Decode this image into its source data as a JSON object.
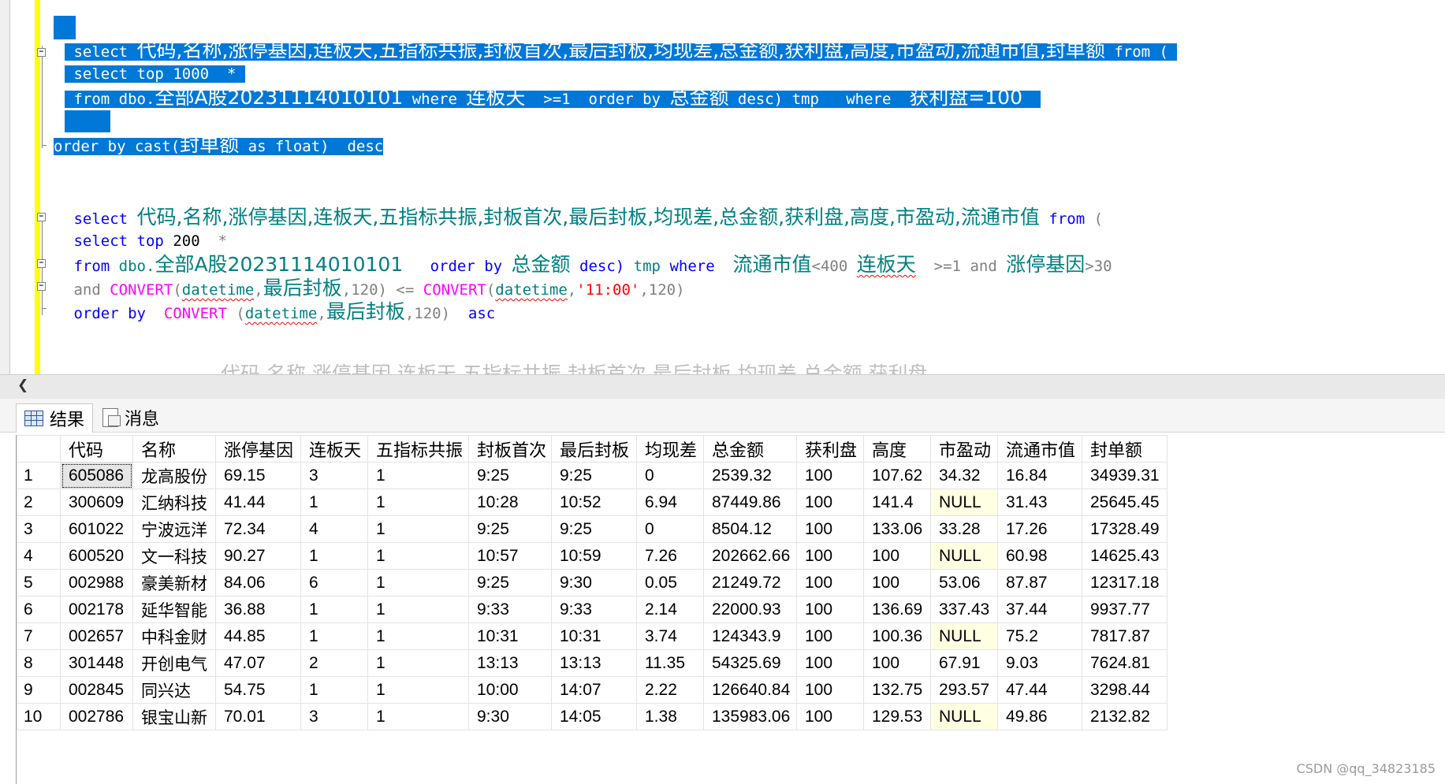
{
  "editor": {
    "block1": {
      "l1": {
        "kw1": "select",
        "cols": "代码,名称,涨停基因,连板天,五指标共振,封板首次,最后封板,均现差,总金额,获利盘,高度,市盈动,流通市值,封单额",
        "kw2": "from",
        "paren": "("
      },
      "l2": {
        "kw1": "select",
        "kw2": "top",
        "num": "1000",
        "star": "*"
      },
      "l3": {
        "kw1": "from",
        "obj1": "dbo.",
        "tbl": "全部A股20231114010101",
        "kw2": "where",
        "col1": "连板天",
        "op1": ">=1",
        "kw3": "order by",
        "col2": "总金额",
        "kw4": "desc)",
        "alias": "tmp",
        "kw5": "where",
        "col3": "获利盘=100"
      },
      "l5": {
        "kw1": "order by cast(",
        "col": "封单额",
        "kw2": "as float)",
        "kw3": "desc"
      }
    },
    "block2": {
      "l1": {
        "kw1": "select",
        "cols": "代码,名称,涨停基因,连板天,五指标共振,封板首次,最后封板,均现差,总金额,获利盘,高度,市盈动,流通市值",
        "kw2": "from",
        "paren": "("
      },
      "l2": {
        "kw1": "select",
        "kw2": "top",
        "num": "200",
        "star": "*"
      },
      "l3": {
        "kw1": "from",
        "obj1": "dbo.",
        "tbl": "全部A股20231114010101",
        "kw2": "order by",
        "col1": "总金额",
        "kw3": "desc)",
        "alias": "tmp",
        "kw4": "where",
        "col2": "流通市值",
        "op1": "<400",
        "col3": "连板天",
        "op2": ">=1",
        "kw5": "and",
        "col4": "涨停基因",
        "op3": ">30"
      },
      "l4": {
        "kw1": "and",
        "fn1": "CONVERT",
        "p1": "(",
        "t1": "datetime",
        "c1": ",",
        "col1": "最后封板",
        "r1": ",120)",
        "op": "<=",
        "fn2": "CONVERT",
        "p2": "(",
        "t2": "datetime",
        "c2": ",",
        "str": "'11:00'",
        "r2": ",120)"
      },
      "l5": {
        "kw1": "order by",
        "fn1": "CONVERT",
        "p1": "(",
        "t1": "datetime",
        "c1": ",",
        "col1": "最后封板",
        "r1": ",120)",
        "kw2": "asc"
      }
    },
    "preview": "代码,名称,涨停基因,连板天,五指标共振,封板首次,最后封板,均现差,总金额,获利盘"
  },
  "tabs": {
    "results": "结果",
    "messages": "消息"
  },
  "results": {
    "columns": [
      "",
      "代码",
      "名称",
      "涨停基因",
      "连板天",
      "五指标共振",
      "封板首次",
      "最后封板",
      "均现差",
      "总金额",
      "获利盘",
      "高度",
      "市盈动",
      "流通市值",
      "封单额"
    ],
    "rows": [
      [
        "1",
        "605086",
        "龙高股份",
        "69.15",
        "3",
        "1",
        "9:25",
        "9:25",
        "0",
        "2539.32",
        "100",
        "107.62",
        "34.32",
        "16.84",
        "34939.31"
      ],
      [
        "2",
        "300609",
        "汇纳科技",
        "41.44",
        "1",
        "1",
        "10:28",
        "10:52",
        "6.94",
        "87449.86",
        "100",
        "141.4",
        "NULL",
        "31.43",
        "25645.45"
      ],
      [
        "3",
        "601022",
        "宁波远洋",
        "72.34",
        "4",
        "1",
        "9:25",
        "9:25",
        "0",
        "8504.12",
        "100",
        "133.06",
        "33.28",
        "17.26",
        "17328.49"
      ],
      [
        "4",
        "600520",
        "文一科技",
        "90.27",
        "1",
        "1",
        "10:57",
        "10:59",
        "7.26",
        "202662.66",
        "100",
        "100",
        "NULL",
        "60.98",
        "14625.43"
      ],
      [
        "5",
        "002988",
        "豪美新材",
        "84.06",
        "6",
        "1",
        "9:25",
        "9:30",
        "0.05",
        "21249.72",
        "100",
        "100",
        "53.06",
        "87.87",
        "12317.18"
      ],
      [
        "6",
        "002178",
        "延华智能",
        "36.88",
        "1",
        "1",
        "9:33",
        "9:33",
        "2.14",
        "22000.93",
        "100",
        "136.69",
        "337.43",
        "37.44",
        "9937.77"
      ],
      [
        "7",
        "002657",
        "中科金财",
        "44.85",
        "1",
        "1",
        "10:31",
        "10:31",
        "3.74",
        "124343.9",
        "100",
        "100.36",
        "NULL",
        "75.2",
        "7817.87"
      ],
      [
        "8",
        "301448",
        "开创电气",
        "47.07",
        "2",
        "1",
        "13:13",
        "13:13",
        "11.35",
        "54325.69",
        "100",
        "100",
        "67.91",
        "9.03",
        "7624.81"
      ],
      [
        "9",
        "002845",
        "同兴达",
        "54.75",
        "1",
        "1",
        "10:00",
        "14:07",
        "2.22",
        "126640.84",
        "100",
        "132.75",
        "293.57",
        "47.44",
        "3298.44"
      ],
      [
        "10",
        "002786",
        "银宝山新",
        "70.01",
        "3",
        "1",
        "9:30",
        "14:05",
        "1.38",
        "135983.06",
        "100",
        "129.53",
        "NULL",
        "49.86",
        "2132.82"
      ]
    ]
  },
  "watermark": "CSDN @qq_34823185"
}
